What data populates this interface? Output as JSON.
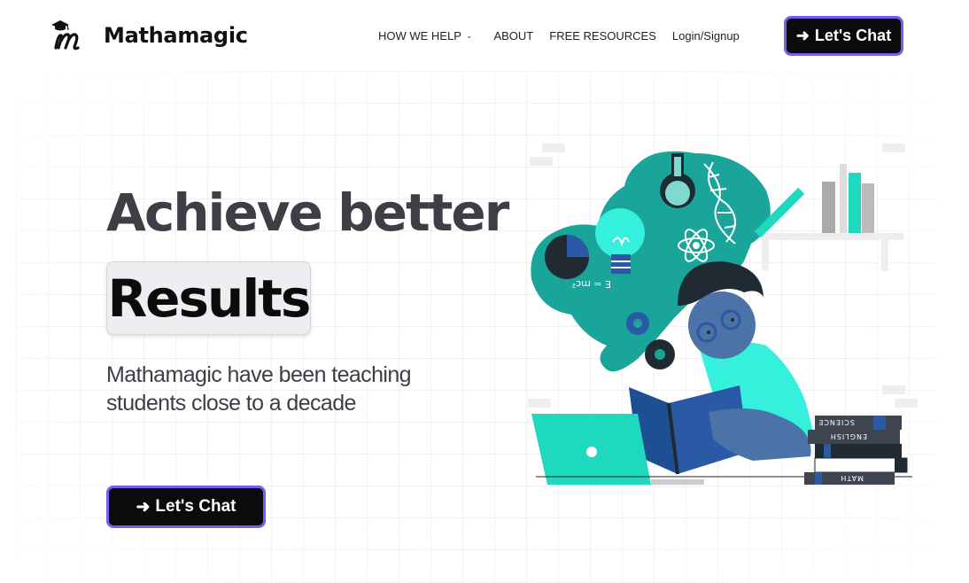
{
  "brand": {
    "name": "Mathamagic"
  },
  "nav": {
    "items": [
      {
        "label": "HOW WE HELP",
        "has_dropdown": true
      },
      {
        "label": "ABOUT",
        "has_dropdown": false
      },
      {
        "label": "FREE RESOURCES",
        "has_dropdown": false
      },
      {
        "label": "Login/Signup",
        "has_dropdown": false
      }
    ],
    "cta_label": "Let's Chat"
  },
  "hero": {
    "title": "Achieve better",
    "highlight": "Results",
    "subtitle": "Mathamagic have been teaching students close to a decade",
    "cta_label": "Let's Chat"
  },
  "illustration": {
    "book_labels": [
      "SCIENCE",
      "ENGLISH",
      "MATH"
    ],
    "formula": "E = mc²"
  },
  "colors": {
    "accent_border": "#7b5cf0",
    "teal": "#1aa59a",
    "heading": "#3e3e46",
    "button_bg": "#0b0b0b"
  },
  "icons": {
    "arrow": "arrow-right-icon",
    "dropdown": "chevron-down-icon"
  }
}
